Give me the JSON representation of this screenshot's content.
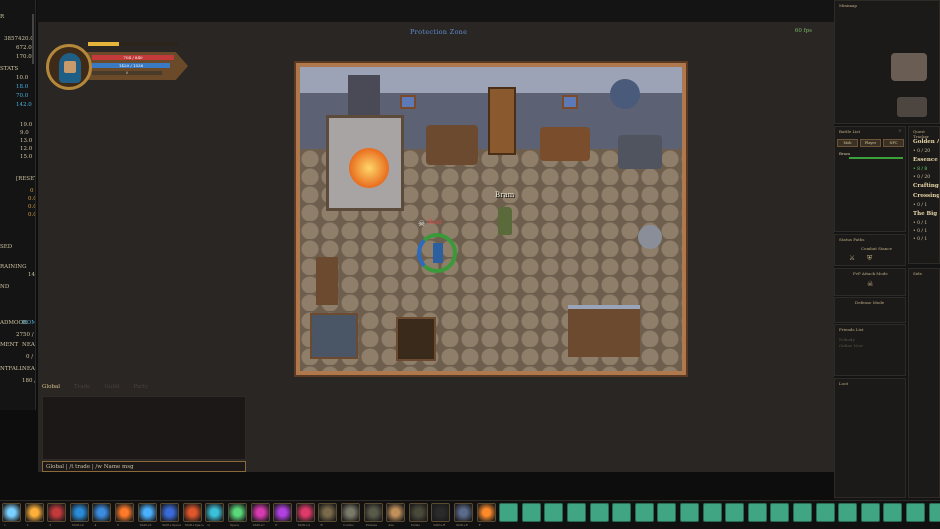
{
  "left": {
    "lines": [
      "R",
      "3857420.0",
      "672.0",
      "170.0",
      "STATS",
      "10.0",
      "18.0",
      "70.0",
      "142.0",
      "19.0",
      "9.0",
      "13.0",
      "12.0",
      "15.0",
      "[RESET]",
      "0",
      "0.0",
      "0.0",
      "0.0",
      "SED",
      "RAINING",
      "14",
      "ND",
      "ADMOOR",
      "HOME",
      "2750 / 3",
      "MENT",
      "NEAR",
      "0 /",
      "NTFALL",
      "NEAR",
      "180 /"
    ]
  },
  "game": {
    "zone": "Protection Zone",
    "fps": "60 fps",
    "npc_name": "Bram",
    "player_tag": "Rest"
  },
  "hud": {
    "hp": "704 / 840",
    "mp": "1420 / 1536",
    "xp": "0"
  },
  "chat": {
    "tabs": [
      "Global",
      "Trade",
      "Guild",
      "Party"
    ],
    "input": "Global  |  /t trade  |  /w Name msg"
  },
  "right": {
    "minimap_title": "Minimap",
    "battle_title": "Battle List",
    "battle_buttons": [
      "Mob",
      "Player",
      "NPC"
    ],
    "battle_entry": "Bram",
    "status_title": "Status Paths",
    "combat_stance": "Combat Stance",
    "pvp_title": "PvP Attack Mode",
    "defense_title": "Defense Mode",
    "friends_title": "Friends List",
    "friends_line1": "Nobody",
    "friends_line2": "Online Now",
    "loot_title": "Loot",
    "quest_title": "Quest Tracker",
    "quests": [
      {
        "t": "h",
        "v": "Golden A"
      },
      {
        "t": "p",
        "v": "• 0 / 20"
      },
      {
        "t": "h",
        "v": "Essence o"
      },
      {
        "t": "g",
        "v": "• 8 / 8"
      },
      {
        "t": "p",
        "v": "• 0 / 20"
      },
      {
        "t": "h",
        "v": "Crafting"
      },
      {
        "t": "h",
        "v": "Crossing"
      },
      {
        "t": "p",
        "v": "• 0 / 1"
      },
      {
        "t": "h",
        "v": "The Big C"
      },
      {
        "t": "p",
        "v": "• 0 / 1"
      },
      {
        "t": "p",
        "v": "• 0 / 1"
      },
      {
        "t": "p",
        "v": "• 0 / 1"
      }
    ],
    "side_title": "Side"
  },
  "hotbar": {
    "slots": [
      {
        "c": "#7ad0ff",
        "l": "1"
      },
      {
        "c": "#ffb03a",
        "l": "2"
      },
      {
        "c": "#c23a3a",
        "l": "3"
      },
      {
        "c": "#2a8cd8",
        "l": "Shift+Z"
      },
      {
        "c": "#3a8ce0",
        "l": "4"
      },
      {
        "c": "#ff7a2a",
        "l": "5"
      },
      {
        "c": "#4ab0ff",
        "l": "Shift+X"
      },
      {
        "c": "#3a6ad8",
        "l": "Shift+Space"
      },
      {
        "c": "#e0562a",
        "l": "Shift+Space"
      },
      {
        "c": "#3ac0d8",
        "l": "Q"
      },
      {
        "c": "#5ad87a",
        "l": "Space"
      },
      {
        "c": "#d83ab0",
        "l": "Shift+C"
      },
      {
        "c": "#b040e0",
        "l": "E"
      },
      {
        "c": "#e03a6a",
        "l": "Shift+Q"
      },
      {
        "c": "#7a6a4a",
        "l": "R"
      },
      {
        "c": "#7a7a6a",
        "l": "Combo"
      },
      {
        "c": "#5a5a4a",
        "l": "Pickaxe"
      },
      {
        "c": "#c0905a",
        "l": "Axe"
      },
      {
        "c": "#4a4a3a",
        "l": "Sickle"
      },
      {
        "c": "#2a2a2a",
        "l": "Shift+R"
      },
      {
        "c": "#5a6a8a",
        "l": "Shift+E"
      },
      {
        "c": "#ff8a2a",
        "l": "F"
      }
    ],
    "empty_count": 20
  },
  "colors": {
    "accent": "#b0794d",
    "zone": "#5f8fd2",
    "slot_empty": "#3fa583"
  }
}
